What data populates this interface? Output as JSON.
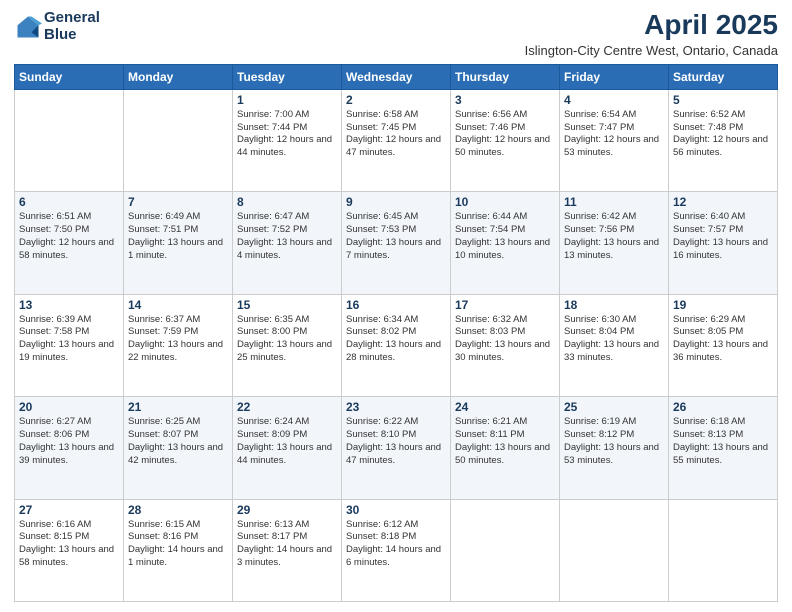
{
  "logo": {
    "line1": "General",
    "line2": "Blue"
  },
  "title": {
    "month_year": "April 2025",
    "location": "Islington-City Centre West, Ontario, Canada"
  },
  "days_of_week": [
    "Sunday",
    "Monday",
    "Tuesday",
    "Wednesday",
    "Thursday",
    "Friday",
    "Saturday"
  ],
  "weeks": [
    [
      {
        "day": "",
        "sunrise": "",
        "sunset": "",
        "daylight": ""
      },
      {
        "day": "",
        "sunrise": "",
        "sunset": "",
        "daylight": ""
      },
      {
        "day": "1",
        "sunrise": "Sunrise: 7:00 AM",
        "sunset": "Sunset: 7:44 PM",
        "daylight": "Daylight: 12 hours and 44 minutes."
      },
      {
        "day": "2",
        "sunrise": "Sunrise: 6:58 AM",
        "sunset": "Sunset: 7:45 PM",
        "daylight": "Daylight: 12 hours and 47 minutes."
      },
      {
        "day": "3",
        "sunrise": "Sunrise: 6:56 AM",
        "sunset": "Sunset: 7:46 PM",
        "daylight": "Daylight: 12 hours and 50 minutes."
      },
      {
        "day": "4",
        "sunrise": "Sunrise: 6:54 AM",
        "sunset": "Sunset: 7:47 PM",
        "daylight": "Daylight: 12 hours and 53 minutes."
      },
      {
        "day": "5",
        "sunrise": "Sunrise: 6:52 AM",
        "sunset": "Sunset: 7:48 PM",
        "daylight": "Daylight: 12 hours and 56 minutes."
      }
    ],
    [
      {
        "day": "6",
        "sunrise": "Sunrise: 6:51 AM",
        "sunset": "Sunset: 7:50 PM",
        "daylight": "Daylight: 12 hours and 58 minutes."
      },
      {
        "day": "7",
        "sunrise": "Sunrise: 6:49 AM",
        "sunset": "Sunset: 7:51 PM",
        "daylight": "Daylight: 13 hours and 1 minute."
      },
      {
        "day": "8",
        "sunrise": "Sunrise: 6:47 AM",
        "sunset": "Sunset: 7:52 PM",
        "daylight": "Daylight: 13 hours and 4 minutes."
      },
      {
        "day": "9",
        "sunrise": "Sunrise: 6:45 AM",
        "sunset": "Sunset: 7:53 PM",
        "daylight": "Daylight: 13 hours and 7 minutes."
      },
      {
        "day": "10",
        "sunrise": "Sunrise: 6:44 AM",
        "sunset": "Sunset: 7:54 PM",
        "daylight": "Daylight: 13 hours and 10 minutes."
      },
      {
        "day": "11",
        "sunrise": "Sunrise: 6:42 AM",
        "sunset": "Sunset: 7:56 PM",
        "daylight": "Daylight: 13 hours and 13 minutes."
      },
      {
        "day": "12",
        "sunrise": "Sunrise: 6:40 AM",
        "sunset": "Sunset: 7:57 PM",
        "daylight": "Daylight: 13 hours and 16 minutes."
      }
    ],
    [
      {
        "day": "13",
        "sunrise": "Sunrise: 6:39 AM",
        "sunset": "Sunset: 7:58 PM",
        "daylight": "Daylight: 13 hours and 19 minutes."
      },
      {
        "day": "14",
        "sunrise": "Sunrise: 6:37 AM",
        "sunset": "Sunset: 7:59 PM",
        "daylight": "Daylight: 13 hours and 22 minutes."
      },
      {
        "day": "15",
        "sunrise": "Sunrise: 6:35 AM",
        "sunset": "Sunset: 8:00 PM",
        "daylight": "Daylight: 13 hours and 25 minutes."
      },
      {
        "day": "16",
        "sunrise": "Sunrise: 6:34 AM",
        "sunset": "Sunset: 8:02 PM",
        "daylight": "Daylight: 13 hours and 28 minutes."
      },
      {
        "day": "17",
        "sunrise": "Sunrise: 6:32 AM",
        "sunset": "Sunset: 8:03 PM",
        "daylight": "Daylight: 13 hours and 30 minutes."
      },
      {
        "day": "18",
        "sunrise": "Sunrise: 6:30 AM",
        "sunset": "Sunset: 8:04 PM",
        "daylight": "Daylight: 13 hours and 33 minutes."
      },
      {
        "day": "19",
        "sunrise": "Sunrise: 6:29 AM",
        "sunset": "Sunset: 8:05 PM",
        "daylight": "Daylight: 13 hours and 36 minutes."
      }
    ],
    [
      {
        "day": "20",
        "sunrise": "Sunrise: 6:27 AM",
        "sunset": "Sunset: 8:06 PM",
        "daylight": "Daylight: 13 hours and 39 minutes."
      },
      {
        "day": "21",
        "sunrise": "Sunrise: 6:25 AM",
        "sunset": "Sunset: 8:07 PM",
        "daylight": "Daylight: 13 hours and 42 minutes."
      },
      {
        "day": "22",
        "sunrise": "Sunrise: 6:24 AM",
        "sunset": "Sunset: 8:09 PM",
        "daylight": "Daylight: 13 hours and 44 minutes."
      },
      {
        "day": "23",
        "sunrise": "Sunrise: 6:22 AM",
        "sunset": "Sunset: 8:10 PM",
        "daylight": "Daylight: 13 hours and 47 minutes."
      },
      {
        "day": "24",
        "sunrise": "Sunrise: 6:21 AM",
        "sunset": "Sunset: 8:11 PM",
        "daylight": "Daylight: 13 hours and 50 minutes."
      },
      {
        "day": "25",
        "sunrise": "Sunrise: 6:19 AM",
        "sunset": "Sunset: 8:12 PM",
        "daylight": "Daylight: 13 hours and 53 minutes."
      },
      {
        "day": "26",
        "sunrise": "Sunrise: 6:18 AM",
        "sunset": "Sunset: 8:13 PM",
        "daylight": "Daylight: 13 hours and 55 minutes."
      }
    ],
    [
      {
        "day": "27",
        "sunrise": "Sunrise: 6:16 AM",
        "sunset": "Sunset: 8:15 PM",
        "daylight": "Daylight: 13 hours and 58 minutes."
      },
      {
        "day": "28",
        "sunrise": "Sunrise: 6:15 AM",
        "sunset": "Sunset: 8:16 PM",
        "daylight": "Daylight: 14 hours and 1 minute."
      },
      {
        "day": "29",
        "sunrise": "Sunrise: 6:13 AM",
        "sunset": "Sunset: 8:17 PM",
        "daylight": "Daylight: 14 hours and 3 minutes."
      },
      {
        "day": "30",
        "sunrise": "Sunrise: 6:12 AM",
        "sunset": "Sunset: 8:18 PM",
        "daylight": "Daylight: 14 hours and 6 minutes."
      },
      {
        "day": "",
        "sunrise": "",
        "sunset": "",
        "daylight": ""
      },
      {
        "day": "",
        "sunrise": "",
        "sunset": "",
        "daylight": ""
      },
      {
        "day": "",
        "sunrise": "",
        "sunset": "",
        "daylight": ""
      }
    ]
  ]
}
